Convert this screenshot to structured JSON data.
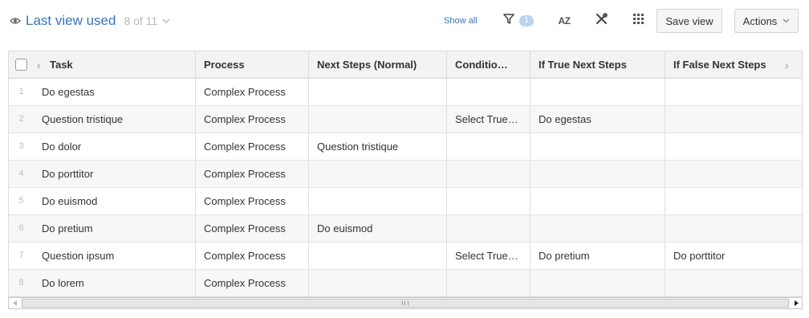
{
  "toolbar": {
    "view_name": "Last view used",
    "view_count": "8 of 11",
    "show_all": "Show all",
    "filter_count": "1",
    "sort_label": "AZ",
    "save_view": "Save view",
    "actions": "Actions"
  },
  "icons": {
    "eye": "eye-icon",
    "chevron": "chevron-down-icon",
    "filter": "filter-icon",
    "sort": "sort-az-icon",
    "tools": "wrench-screwdriver-icon",
    "columns": "columns-grid-icon",
    "scroll_left": "caret-left-icon",
    "scroll_right": "caret-right-icon"
  },
  "colors": {
    "accent": "#3b73b9",
    "badge": "#b9d4ec",
    "header_bg": "#f3f3f3",
    "stripe_bg": "#f7f7f7"
  },
  "table": {
    "columns": [
      "Task",
      "Process",
      "Next Steps (Normal)",
      "Conditio…",
      "If True Next Steps",
      "If False Next Steps"
    ],
    "rows": [
      {
        "num": "1",
        "task": "Do egestas",
        "process": "Complex Process",
        "next": "",
        "cond": "",
        "if_true": "",
        "if_false": ""
      },
      {
        "num": "2",
        "task": "Question tristique",
        "process": "Complex Process",
        "next": "",
        "cond": "Select True…",
        "if_true": "Do egestas",
        "if_false": ""
      },
      {
        "num": "3",
        "task": "Do dolor",
        "process": "Complex Process",
        "next": "Question tristique",
        "cond": "",
        "if_true": "",
        "if_false": ""
      },
      {
        "num": "4",
        "task": "Do porttitor",
        "process": "Complex Process",
        "next": "",
        "cond": "",
        "if_true": "",
        "if_false": ""
      },
      {
        "num": "5",
        "task": "Do euismod",
        "process": "Complex Process",
        "next": "",
        "cond": "",
        "if_true": "",
        "if_false": ""
      },
      {
        "num": "6",
        "task": "Do pretium",
        "process": "Complex Process",
        "next": "Do euismod",
        "cond": "",
        "if_true": "",
        "if_false": ""
      },
      {
        "num": "7",
        "task": "Question ipsum",
        "process": "Complex Process",
        "next": "",
        "cond": "Select True…",
        "if_true": "Do pretium",
        "if_false": "Do porttitor"
      },
      {
        "num": "8",
        "task": "Do lorem",
        "process": "Complex Process",
        "next": "",
        "cond": "",
        "if_true": "",
        "if_false": ""
      }
    ]
  }
}
